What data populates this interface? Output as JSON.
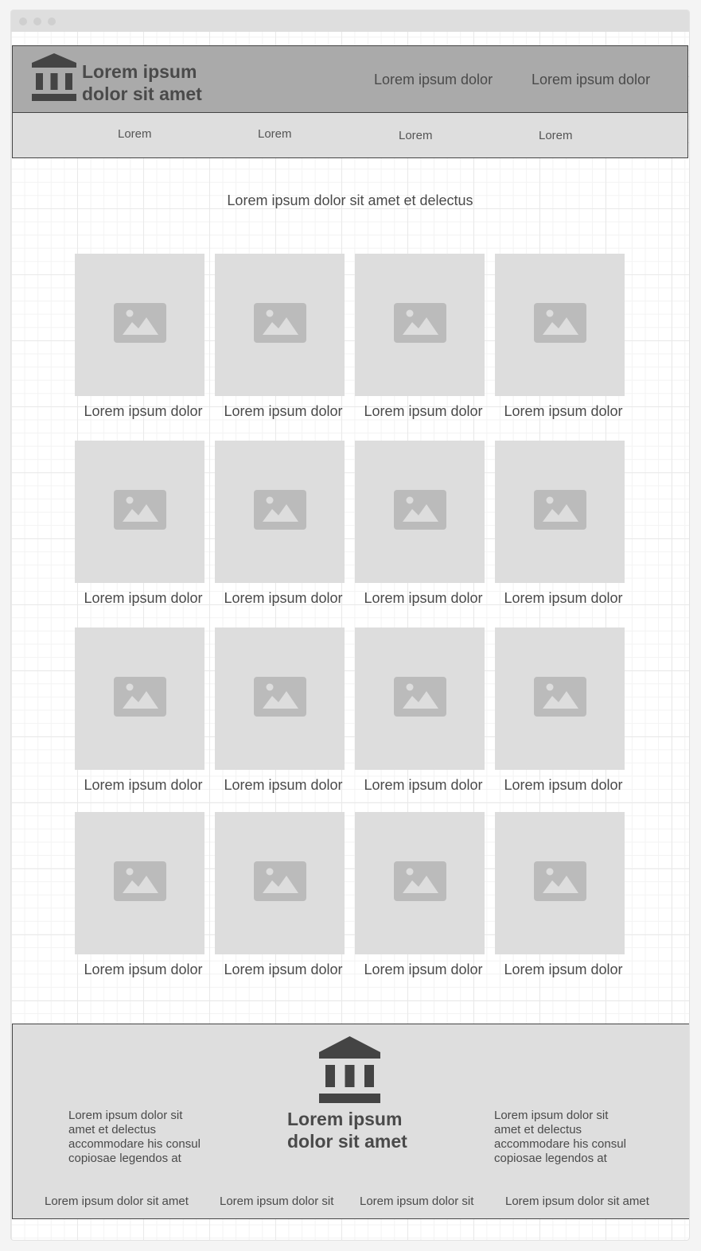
{
  "window": {
    "dots": [
      "close",
      "minimize",
      "maximize"
    ]
  },
  "header": {
    "brand_line1": "Lorem ipsum",
    "brand_line2": "dolor sit amet",
    "logo_icon": "bank-icon",
    "links": [
      "Lorem ipsum dolor",
      "Lorem ipsum dolor"
    ]
  },
  "subnav": {
    "items": [
      "Lorem",
      "Lorem",
      "Lorem",
      "Lorem"
    ]
  },
  "intro": "Lorem ipsum dolor sit amet et delectus",
  "gallery": {
    "image_icon": "image-placeholder-icon",
    "captions": [
      "Lorem ipsum dolor",
      "Lorem ipsum dolor",
      "Lorem ipsum dolor",
      "Lorem ipsum dolor",
      "Lorem ipsum dolor",
      "Lorem ipsum dolor",
      "Lorem ipsum dolor",
      "Lorem ipsum dolor",
      "Lorem ipsum dolor",
      "Lorem ipsum dolor",
      "Lorem ipsum dolor",
      "Lorem ipsum dolor",
      "Lorem ipsum dolor",
      "Lorem ipsum dolor",
      "Lorem ipsum dolor",
      "Lorem ipsum dolor"
    ]
  },
  "footer": {
    "brand_line1": "Lorem ipsum",
    "brand_line2": "dolor sit amet",
    "text_left": [
      "Lorem ipsum dolor sit",
      "amet et delectus",
      "accommodare his consul",
      "copiosae legendos at"
    ],
    "text_right": [
      "Lorem ipsum dolor sit",
      "amet et delectus",
      "accommodare his consul",
      "copiosae legendos at"
    ],
    "links": [
      "Lorem ipsum dolor sit amet",
      "Lorem ipsum dolor sit",
      "Lorem ipsum dolor sit",
      "Lorem ipsum dolor sit amet"
    ]
  },
  "colors": {
    "header_bg": "#aaaaaa",
    "subnav_bg": "#dedede",
    "placeholder_bg": "#dddddd",
    "placeholder_icon": "#bbbbbb",
    "text": "#4a4a4a"
  }
}
